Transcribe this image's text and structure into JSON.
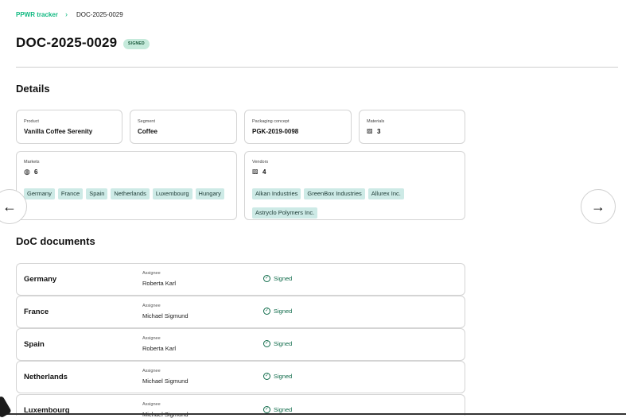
{
  "breadcrumb": {
    "root": "PPWR tracker",
    "separator": "›",
    "current": "DOC-2025-0029"
  },
  "header": {
    "title": "DOC-2025-0029",
    "status": "SIGNED"
  },
  "details": {
    "heading": "Details",
    "product": {
      "label": "Product",
      "value": "Vanilla Coffee Serenity"
    },
    "segment": {
      "label": "Segment",
      "value": "Coffee"
    },
    "packaging": {
      "label": "Packaging concept",
      "value": "PGK-2019-0098"
    },
    "materials": {
      "label": "Materials",
      "value": "3"
    },
    "markets": {
      "label": "Markets",
      "count": "6",
      "items": [
        "Germany",
        "France",
        "Spain",
        "Netherlands",
        "Luxembourg",
        "Hungary"
      ]
    },
    "vendors": {
      "label": "Vendors",
      "count": "4",
      "items": [
        "Alkan Industries",
        "GreenBox Industries",
        "Allurex Inc.",
        "Astryclo Polymers Inc."
      ]
    }
  },
  "doc": {
    "heading": "DoC documents",
    "assignee_label": "Assignee",
    "rows": [
      {
        "country": "Germany",
        "assignee": "Roberta Karl",
        "status": "Signed"
      },
      {
        "country": "France",
        "assignee": "Michael Sigmund",
        "status": "Signed"
      },
      {
        "country": "Spain",
        "assignee": "Roberta Karl",
        "status": "Signed"
      },
      {
        "country": "Netherlands",
        "assignee": "Michael Sigmund",
        "status": "Signed"
      },
      {
        "country": "Luxembourg",
        "assignee": "Michael Sigmund",
        "status": "Signed"
      }
    ]
  },
  "nav": {
    "prev_icon": "arrow-left-icon",
    "next_icon": "arrow-right-icon",
    "prev": "←",
    "next": "→"
  },
  "colors": {
    "accent": "#10b981",
    "badge_bg": "#c5eadb",
    "chip_bg": "#cdeae6",
    "status_green": "#0f6b4a"
  }
}
